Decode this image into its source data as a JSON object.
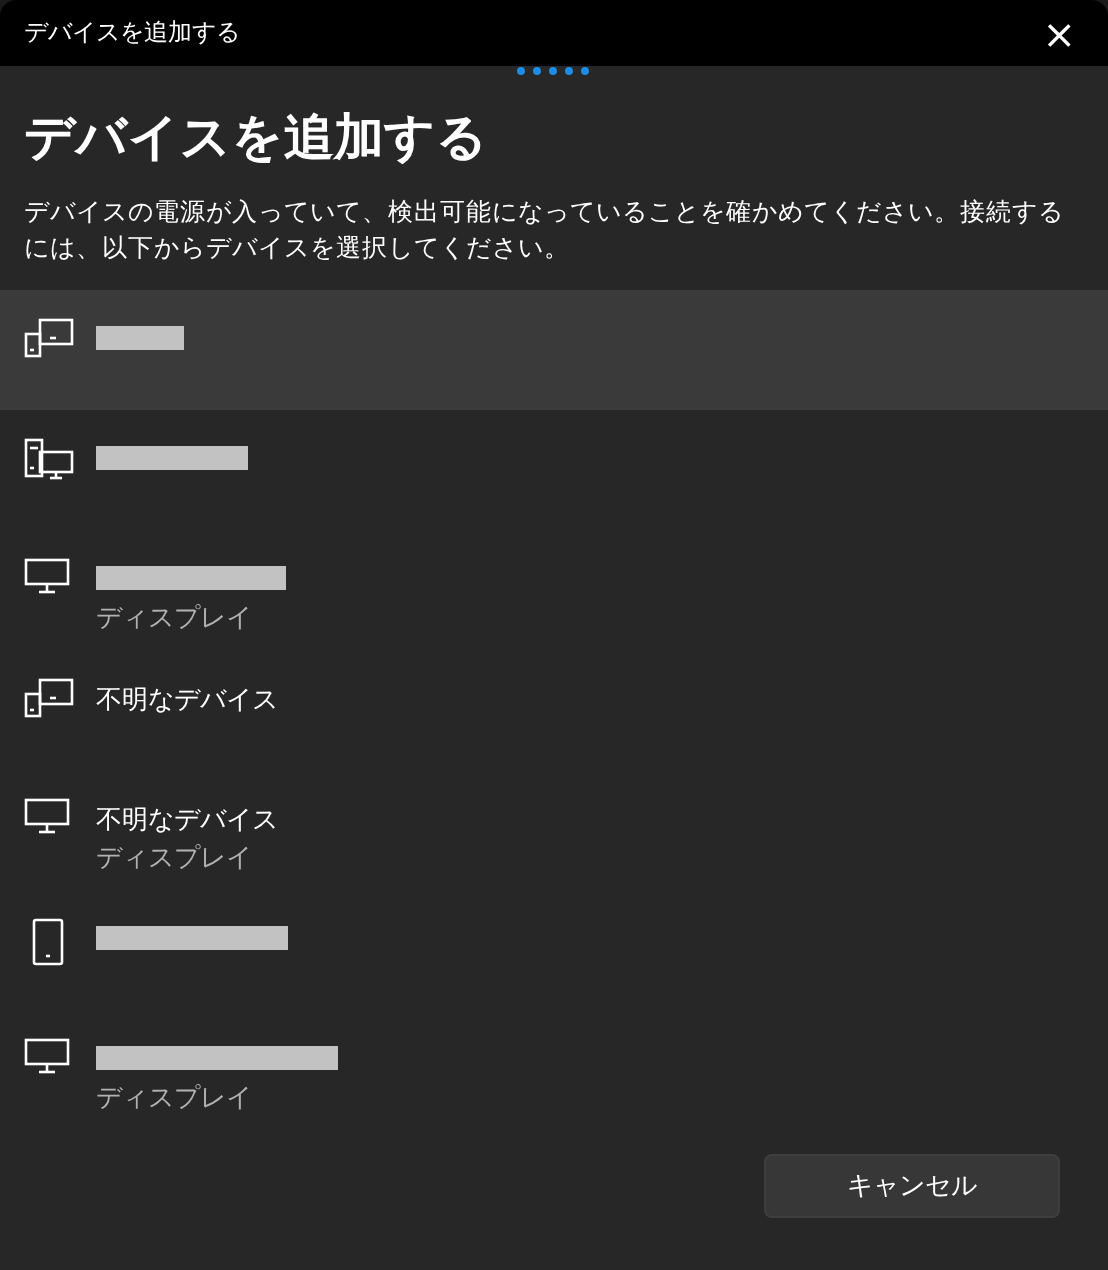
{
  "window": {
    "title": "デバイスを追加する",
    "close": "×"
  },
  "heading": "デバイスを追加する",
  "description": "デバイスの電源が入っていて、検出可能になっていることを確かめてください。接続するには、以下からデバイスを選択してください。",
  "devices": [
    {
      "kind": "phone-pc",
      "redacted": true,
      "selected": true
    },
    {
      "kind": "desktop",
      "redacted": true,
      "selected": false
    },
    {
      "kind": "monitor",
      "redacted": true,
      "subtitle": "ディスプレイ",
      "selected": false
    },
    {
      "kind": "phone-pc",
      "name": "不明なデバイス",
      "selected": false
    },
    {
      "kind": "monitor",
      "name": "不明なデバイス",
      "subtitle": "ディスプレイ",
      "selected": false
    },
    {
      "kind": "phone",
      "redacted": true,
      "selected": false
    },
    {
      "kind": "monitor",
      "redacted": true,
      "subtitle": "ディスプレイ",
      "selected": false
    }
  ],
  "buttons": [
    "キャンセル"
  ]
}
